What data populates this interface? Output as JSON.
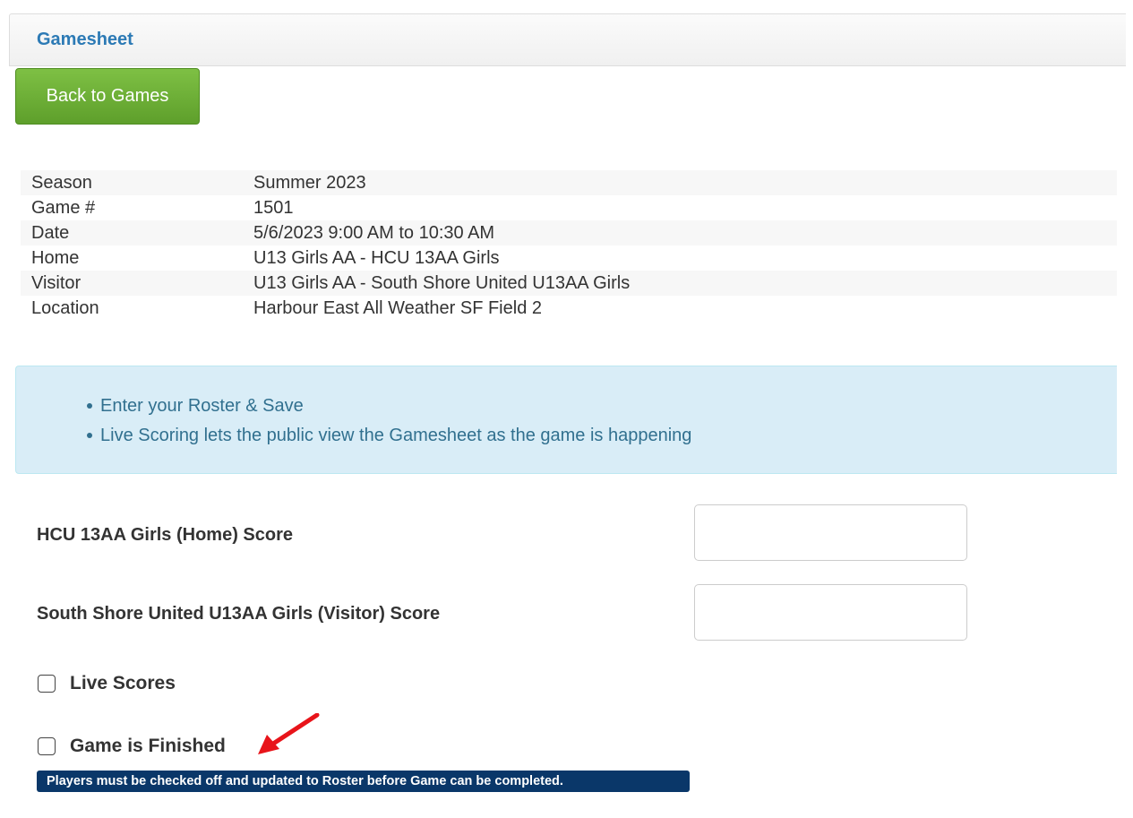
{
  "panel": {
    "title": "Gamesheet"
  },
  "back_button": {
    "label": "Back to Games"
  },
  "game_info": [
    {
      "label": "Season",
      "value": "Summer 2023"
    },
    {
      "label": "Game #",
      "value": "1501"
    },
    {
      "label": "Date",
      "value": "5/6/2023 9:00 AM to 10:30 AM"
    },
    {
      "label": "Home",
      "value": "U13 Girls AA - HCU 13AA Girls"
    },
    {
      "label": "Visitor",
      "value": "U13 Girls AA - South Shore United U13AA Girls"
    },
    {
      "label": "Location",
      "value": "Harbour East All Weather SF Field 2"
    }
  ],
  "info_alert": {
    "items": [
      "Enter your Roster & Save",
      "Live Scoring lets the public view the Gamesheet as the game is happening"
    ]
  },
  "scores": {
    "home_label": "HCU 13AA Girls (Home) Score",
    "home_value": "",
    "visitor_label": "South Shore United U13AA Girls (Visitor) Score",
    "visitor_value": ""
  },
  "checkboxes": {
    "live_scores": {
      "label": "Live Scores",
      "checked": false
    },
    "game_finished": {
      "label": "Game is Finished",
      "checked": false
    }
  },
  "notice": {
    "text": "Players must be checked off and updated to Roster before Game can be completed."
  },
  "annotation": {
    "arrow_color": "#e8141a",
    "icon": "red-arrow-icon"
  }
}
